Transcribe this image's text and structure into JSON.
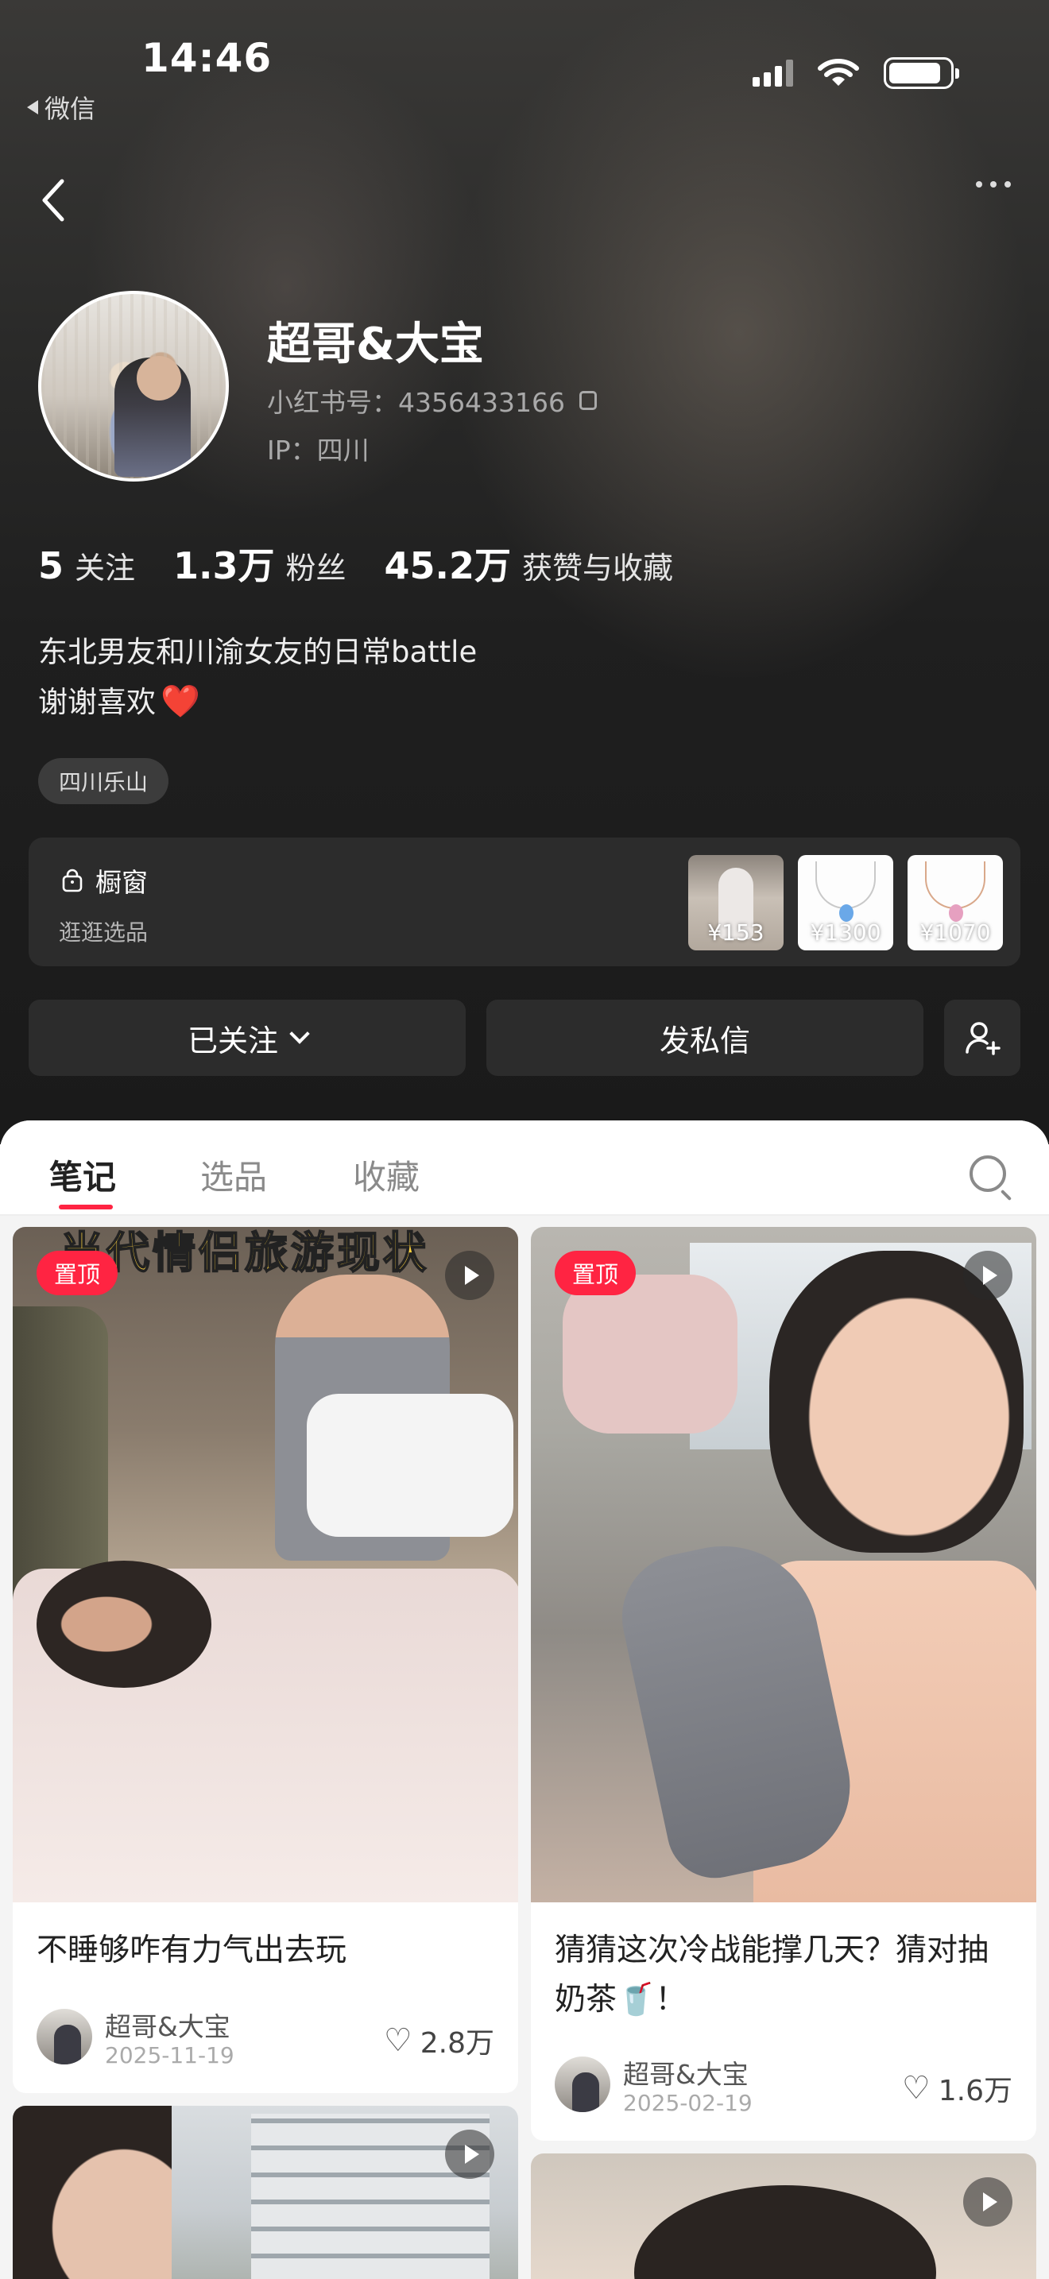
{
  "status_bar": {
    "time": "14:46",
    "back_app_label": "微信"
  },
  "profile": {
    "name": "超哥&大宝",
    "id_text": "小红书号：4356433166",
    "ip_text": "IP：四川",
    "stats": [
      {
        "num": "5",
        "label": "关注"
      },
      {
        "num": "1.3万",
        "label": "粉丝"
      },
      {
        "num": "45.2万",
        "label": "获赞与收藏"
      }
    ],
    "bio_line1": "东北男友和川渝女友的日常battle",
    "bio_line2": "谢谢喜欢",
    "bio_emoji": "❤️",
    "location_tag": "四川乐山"
  },
  "shop": {
    "title": "橱窗",
    "subtitle": "逛逛选品",
    "items": [
      {
        "price": "¥153"
      },
      {
        "price": "¥1300"
      },
      {
        "price": "¥1070"
      }
    ]
  },
  "actions": {
    "follow_label": "已关注",
    "message_label": "发私信"
  },
  "tabs": [
    "笔记",
    "选品",
    "收藏"
  ],
  "notes": [
    {
      "badge": "置顶",
      "image_caption": "当代情侣旅游现状",
      "title": "不睡够咋有力气出去玩",
      "author": "超哥&大宝",
      "date": "2025-11-19",
      "likes": "2.8万"
    },
    {
      "badge": "置顶",
      "title": "猜猜这次冷战能撑几天？猜对抽奶茶🥤！",
      "author": "超哥&大宝",
      "date": "2025-02-19",
      "likes": "1.6万"
    }
  ],
  "colors": {
    "accent": "#ff2442",
    "header_bg": "#1f1f1f",
    "sheet_bg": "#f4f4f4"
  }
}
